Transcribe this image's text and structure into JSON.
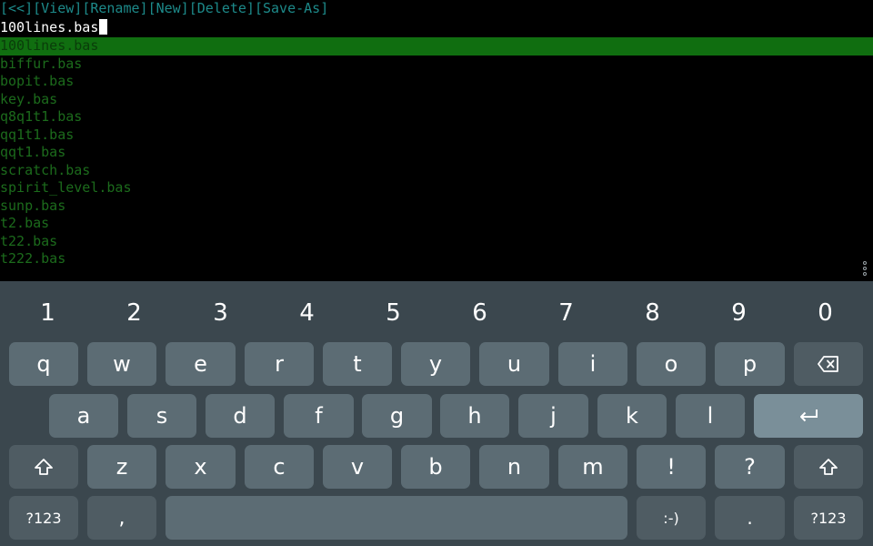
{
  "menu": {
    "items": [
      "[<<]",
      "[View]",
      "[Rename]",
      "[New]",
      "[Delete]",
      "[Save-As]"
    ]
  },
  "input": {
    "value": "100lines.bas"
  },
  "files": [
    "100lines.bas",
    "biffur.bas",
    "bopit.bas",
    "key.bas",
    "q8q1t1.bas",
    "qq1t1.bas",
    "qqt1.bas",
    "scratch.bas",
    "spirit_level.bas",
    "sunp.bas",
    "t2.bas",
    "t22.bas",
    "t222.bas"
  ],
  "selected_file_index": 0,
  "overflow_menu_icon": "three-dots-vertical-icon",
  "keyboard": {
    "number_row": [
      "1",
      "2",
      "3",
      "4",
      "5",
      "6",
      "7",
      "8",
      "9",
      "0"
    ],
    "row1": [
      "q",
      "w",
      "e",
      "r",
      "t",
      "y",
      "u",
      "i",
      "o",
      "p"
    ],
    "row2": [
      "a",
      "s",
      "d",
      "f",
      "g",
      "h",
      "j",
      "k",
      "l"
    ],
    "row3": [
      "z",
      "x",
      "c",
      "v",
      "b",
      "n",
      "m",
      "!",
      "?"
    ],
    "symbols_label": "?123",
    "comma_label": ",",
    "emoticon_label": ":-)",
    "period_label": ".",
    "icons": {
      "backspace": "backspace-icon",
      "enter": "enter-arrow-icon",
      "shift": "shift-arrow-icon"
    }
  },
  "colors": {
    "menu_text": "#1d8a8a",
    "file_text": "#1c6b1c",
    "selection_bg": "#106e10",
    "keyboard_bg": "#3b474e",
    "key_bg": "#5c6c74",
    "func_key_bg": "#4f5c63",
    "enter_key_bg": "#7a8f99"
  }
}
